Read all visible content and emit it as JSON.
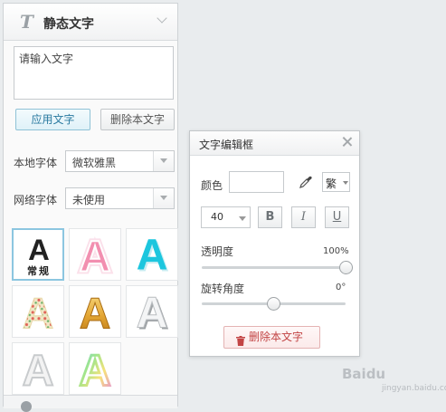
{
  "panel": {
    "title": "静态文字",
    "text_value": "请输入文字",
    "apply_label": "应用文字",
    "delete_label": "删除本文字",
    "local_font_label": "本地字体",
    "local_font_value": "微软雅黑",
    "web_font_label": "网络字体",
    "web_font_value": "未使用",
    "style_tiles": [
      {
        "name": "style-regular",
        "sample": "A",
        "caption": "常规"
      },
      {
        "name": "style-pink-glow",
        "sample": "A"
      },
      {
        "name": "style-cyan",
        "sample": "A"
      },
      {
        "name": "style-polka",
        "sample": "A"
      },
      {
        "name": "style-gold",
        "sample": "A"
      },
      {
        "name": "style-silver",
        "sample": "A"
      },
      {
        "name": "style-outline-gray",
        "sample": "A"
      },
      {
        "name": "style-rainbow",
        "sample": "A"
      }
    ]
  },
  "dialog": {
    "title": "文字编辑框",
    "color_label": "颜色",
    "script_value": "繁",
    "font_size_value": "40",
    "bold_label": "B",
    "italic_label": "I",
    "underline_label": "U",
    "opacity_label": "透明度",
    "opacity_value": "100%",
    "opacity_fraction": 1.0,
    "rotation_label": "旋转角度",
    "rotation_value": "0°",
    "rotation_fraction": 0.5,
    "delete_label": "删除本文字"
  },
  "watermark": {
    "text": "Baidu",
    "sub": "jingyan.baidu.com"
  },
  "colors": {
    "accent_blue": "#2a7aa0",
    "delete_red": "#c24444",
    "pink": "#f28fb0",
    "cyan": "#1cc6de",
    "gold": "#e3a533"
  }
}
